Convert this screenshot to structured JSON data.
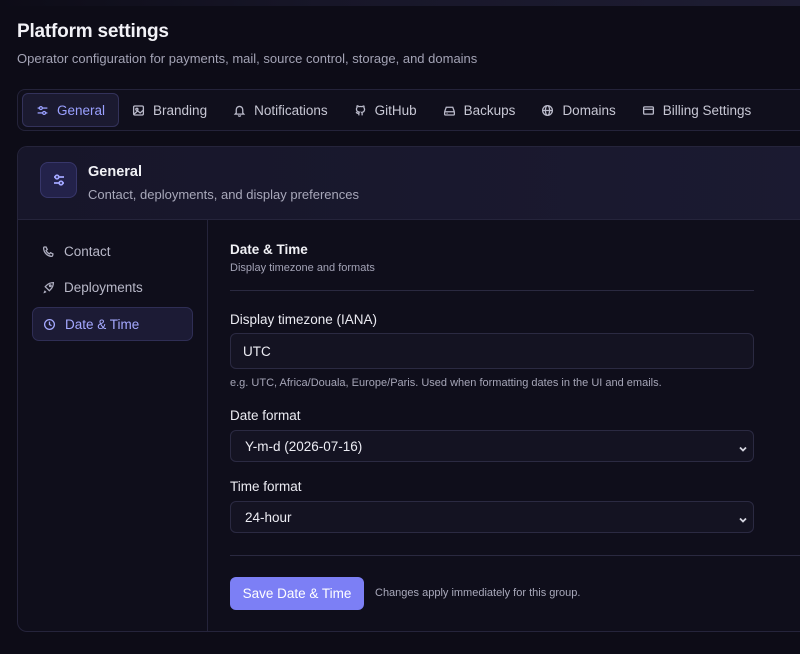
{
  "page": {
    "title": "Platform settings",
    "subtitle": "Operator configuration for payments, mail, source control, storage, and domains"
  },
  "tabs": [
    {
      "label": "General",
      "icon": "sliders-icon",
      "active": true
    },
    {
      "label": "Branding",
      "icon": "image-icon",
      "active": false
    },
    {
      "label": "Notifications",
      "icon": "bell-icon",
      "active": false
    },
    {
      "label": "GitHub",
      "icon": "github-icon",
      "active": false
    },
    {
      "label": "Backups",
      "icon": "hard-drive-icon",
      "active": false
    },
    {
      "label": "Domains",
      "icon": "globe-icon",
      "active": false
    },
    {
      "label": "Billing Settings",
      "icon": "credit-card-icon",
      "active": false
    }
  ],
  "card": {
    "icon": "sliders-icon",
    "title": "General",
    "subtitle": "Contact, deployments, and display preferences"
  },
  "sidenav": [
    {
      "label": "Contact",
      "icon": "phone-icon",
      "active": false
    },
    {
      "label": "Deployments",
      "icon": "rocket-icon",
      "active": false
    },
    {
      "label": "Date & Time",
      "icon": "clock-icon",
      "active": true
    }
  ],
  "section": {
    "title": "Date & Time",
    "subtitle": "Display timezone and formats"
  },
  "fields": {
    "timezone": {
      "label": "Display timezone (IANA)",
      "value": "UTC",
      "hint": "e.g. UTC, Africa/Douala, Europe/Paris. Used when formatting dates in the UI and emails."
    },
    "date_format": {
      "label": "Date format",
      "value": "Y-m-d (2026-07-16)"
    },
    "time_format": {
      "label": "Time format",
      "value": "24-hour"
    }
  },
  "actions": {
    "save_label": "Save Date & Time",
    "note": "Changes apply immediately for this group."
  },
  "colors": {
    "accent": "#7c7ff5",
    "accent_text": "#9aa0ff",
    "background": "#0d0c17"
  }
}
